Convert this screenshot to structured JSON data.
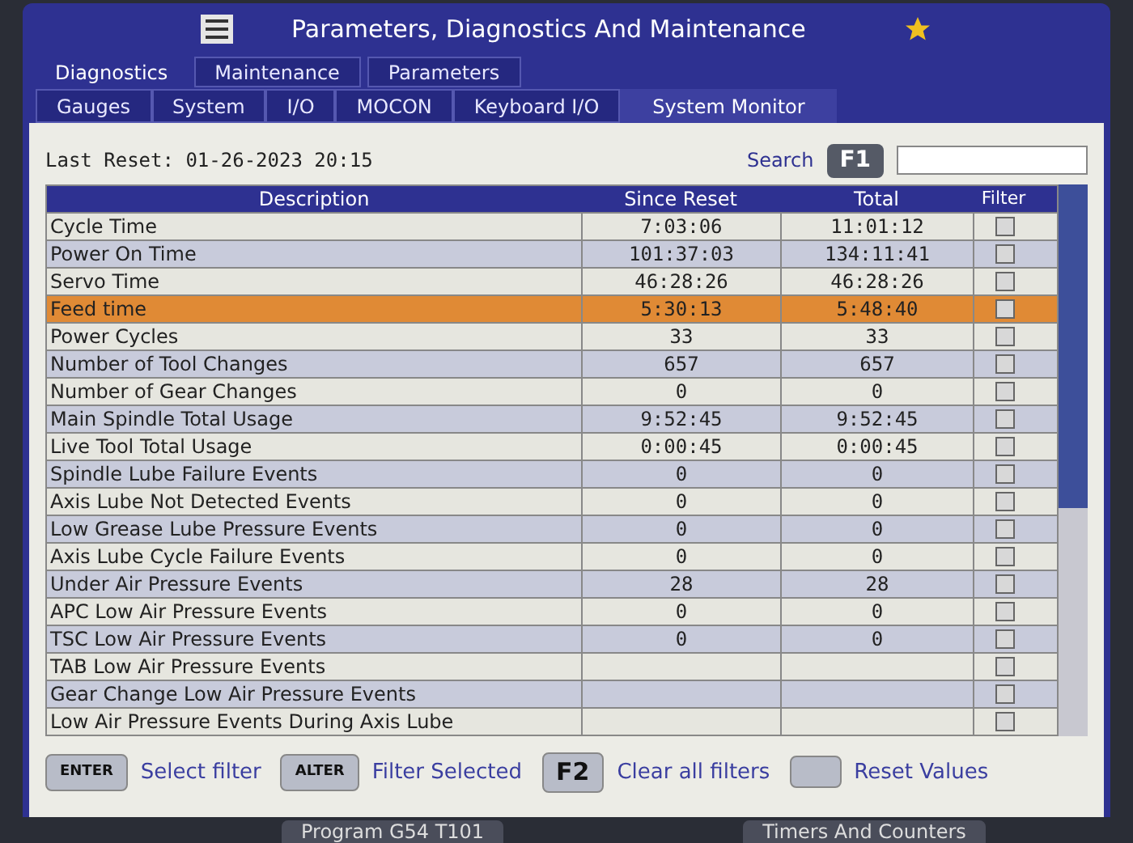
{
  "window": {
    "title": "Parameters, Diagnostics And Maintenance"
  },
  "tabs": [
    {
      "label": "Diagnostics",
      "selected": true
    },
    {
      "label": "Maintenance",
      "selected": false
    },
    {
      "label": "Parameters",
      "selected": false
    }
  ],
  "subtabs": [
    {
      "label": "Gauges",
      "selected": false
    },
    {
      "label": "System",
      "selected": false
    },
    {
      "label": "I/O",
      "selected": false
    },
    {
      "label": "MOCON",
      "selected": false
    },
    {
      "label": "Keyboard I/O",
      "selected": false
    },
    {
      "label": "System Monitor",
      "selected": true
    }
  ],
  "last_reset": "Last Reset: 01-26-2023 20:15",
  "search": {
    "label": "Search",
    "key": "F1"
  },
  "table": {
    "columns": [
      "Description",
      "Since Reset",
      "Total",
      "Filter"
    ],
    "rows": [
      {
        "description": "Cycle Time",
        "since_reset": "7:03:06",
        "total": "11:01:12",
        "selected": false,
        "checked": false
      },
      {
        "description": "Power On Time",
        "since_reset": "101:37:03",
        "total": "134:11:41",
        "selected": false,
        "checked": false
      },
      {
        "description": "Servo Time",
        "since_reset": "46:28:26",
        "total": "46:28:26",
        "selected": false,
        "checked": false
      },
      {
        "description": "Feed time",
        "since_reset": "5:30:13",
        "total": "5:48:40",
        "selected": true,
        "checked": false
      },
      {
        "description": "Power Cycles",
        "since_reset": "33",
        "total": "33",
        "selected": false,
        "checked": false
      },
      {
        "description": "Number of Tool Changes",
        "since_reset": "657",
        "total": "657",
        "selected": false,
        "checked": false
      },
      {
        "description": "Number of Gear Changes",
        "since_reset": "0",
        "total": "0",
        "selected": false,
        "checked": false
      },
      {
        "description": "Main Spindle Total Usage",
        "since_reset": "9:52:45",
        "total": "9:52:45",
        "selected": false,
        "checked": false
      },
      {
        "description": "Live Tool Total Usage",
        "since_reset": "0:00:45",
        "total": "0:00:45",
        "selected": false,
        "checked": false
      },
      {
        "description": "Spindle Lube Failure Events",
        "since_reset": "0",
        "total": "0",
        "selected": false,
        "checked": false
      },
      {
        "description": "Axis Lube Not Detected Events",
        "since_reset": "0",
        "total": "0",
        "selected": false,
        "checked": false
      },
      {
        "description": "Low Grease Lube Pressure Events",
        "since_reset": "0",
        "total": "0",
        "selected": false,
        "checked": false
      },
      {
        "description": "Axis Lube Cycle Failure Events",
        "since_reset": "0",
        "total": "0",
        "selected": false,
        "checked": false
      },
      {
        "description": "Under Air Pressure Events",
        "since_reset": "28",
        "total": "28",
        "selected": false,
        "checked": false
      },
      {
        "description": "APC Low Air Pressure Events",
        "since_reset": "0",
        "total": "0",
        "selected": false,
        "checked": false
      },
      {
        "description": "TSC Low Air Pressure Events",
        "since_reset": "0",
        "total": "0",
        "selected": false,
        "checked": false
      },
      {
        "description": "TAB Low Air Pressure Events",
        "selected": false,
        "checked": false
      },
      {
        "description": "Gear Change Low Air Pressure Events",
        "selected": false,
        "checked": false
      },
      {
        "description": "Low Air Pressure Events During Axis Lube",
        "selected": false,
        "checked": false
      }
    ]
  },
  "functions": [
    {
      "key": "ENTER",
      "label": "Select filter"
    },
    {
      "key": "ALTER",
      "label": "Filter Selected"
    },
    {
      "key": "F2",
      "label": "Clear all filters"
    },
    {
      "label": "Reset Values"
    }
  ],
  "bottom_tabs": [
    "Program G54 T101",
    "Timers And Counters"
  ]
}
